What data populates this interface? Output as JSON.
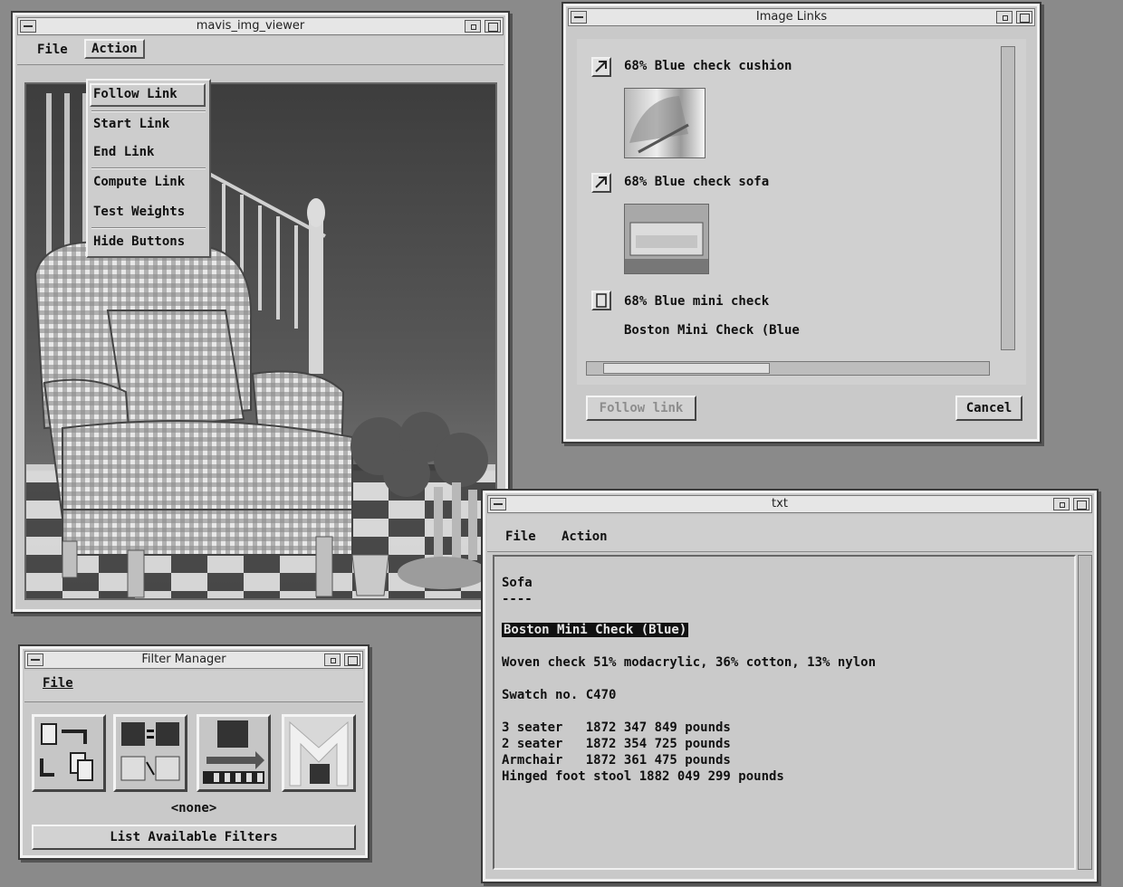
{
  "viewer": {
    "title": "mavis_img_viewer",
    "menu": {
      "file": "File",
      "action": "Action"
    },
    "action_menu": [
      "Follow Link",
      "Start Link",
      "End Link",
      "Compute Link",
      "Test Weights",
      "Hide Buttons"
    ]
  },
  "links": {
    "title": "Image Links",
    "items": [
      {
        "label": "68% Blue check cushion"
      },
      {
        "label": "68% Blue check sofa"
      },
      {
        "label": "68% Blue mini check",
        "detail": "Boston Mini Check (Blue"
      }
    ],
    "follow_label": "Follow link",
    "cancel_label": "Cancel"
  },
  "txt": {
    "title": "txt",
    "menu": {
      "file": "File",
      "action": "Action"
    },
    "lines": {
      "heading": "Sofa",
      "underline": "----",
      "selected": "Boston Mini Check (Blue)",
      "fabric": "Woven check 51% modacrylic, 36% cotton, 13% nylon",
      "swatch": "Swatch no. C470",
      "price1": "3 seater   1872 347 849 pounds",
      "price2": "2 seater   1872 354 725 pounds",
      "price3": "Armchair   1872 361 475 pounds",
      "price4": "Hinged foot stool 1882 049 299 pounds"
    }
  },
  "filter": {
    "title": "Filter Manager",
    "menu": {
      "file": "File"
    },
    "status": "<none>",
    "list_label": "List Available Filters"
  }
}
